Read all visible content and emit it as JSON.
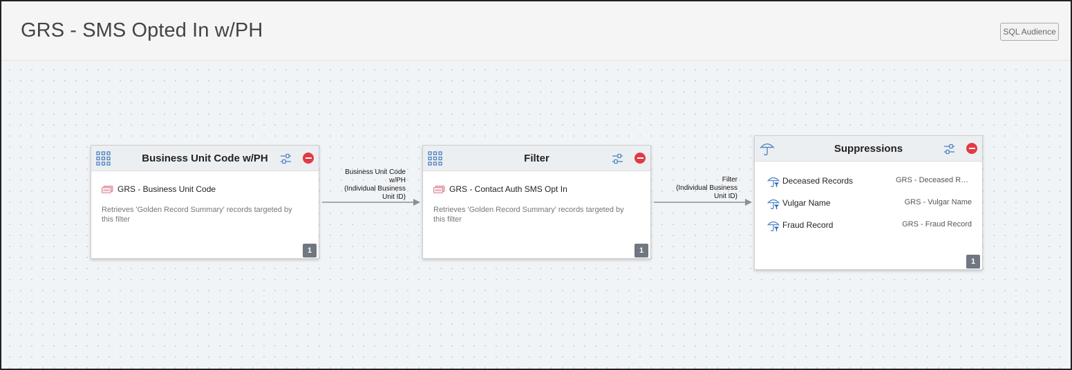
{
  "header": {
    "title": "GRS - SMS Opted In w/PH",
    "sql_button": "SQL Audience"
  },
  "nodes": [
    {
      "title": "Business Unit Code w/PH",
      "item": "GRS - Business Unit Code",
      "description": "Retrieves 'Golden Record Summary' records targeted by this filter",
      "count": "1"
    },
    {
      "title": "Filter",
      "item": "GRS - Contact Auth SMS Opt In",
      "description": "Retrieves 'Golden Record Summary' records targeted by this filter",
      "count": "1"
    }
  ],
  "connectors": [
    {
      "label_lines": [
        "Business Unit Code",
        "w/PH",
        "(Individual Business",
        "Unit ID)"
      ]
    },
    {
      "label_lines": [
        "Filter",
        "(Individual Business",
        "Unit ID)"
      ]
    }
  ],
  "suppressions": {
    "title": "Suppressions",
    "count": "1",
    "items": [
      {
        "name": "Deceased Records",
        "source": "GRS - Deceased Records"
      },
      {
        "name": "Vulgar Name",
        "source": "GRS - Vulgar Name"
      },
      {
        "name": "Fraud Record",
        "source": "GRS - Fraud Record"
      }
    ]
  },
  "colors": {
    "accent_blue": "#4a7fc1",
    "remove_red": "#e23a44",
    "badge_gray": "#6f7780",
    "connector_gray": "#8a9096"
  },
  "icons": {
    "node_type": "grid-icon",
    "suppression_type": "umbrella-icon",
    "settings": "sliders-icon",
    "remove": "remove-icon",
    "record": "record-card-icon",
    "suppression_item": "umbrella-filter-icon"
  }
}
